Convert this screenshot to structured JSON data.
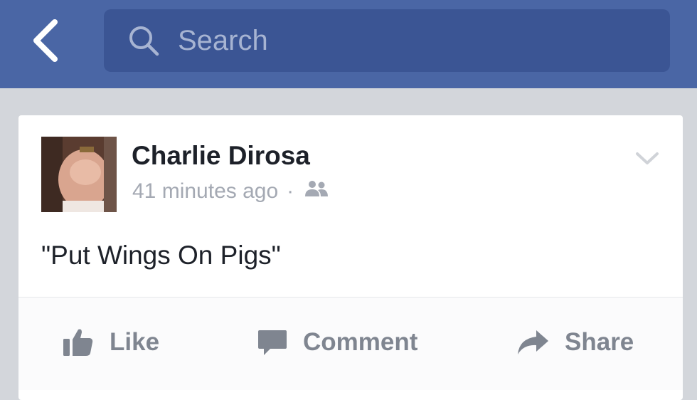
{
  "header": {
    "search_placeholder": "Search"
  },
  "post": {
    "author": "Charlie Dirosa",
    "timestamp": "41 minutes ago",
    "separator": "·",
    "privacy_icon": "friends-icon",
    "text": "\"Put Wings On Pigs\""
  },
  "actions": {
    "like_label": "Like",
    "comment_label": "Comment",
    "share_label": "Share"
  },
  "colors": {
    "navbar": "#4a66a5",
    "search_bg": "#3b5594",
    "background": "#d3d6db",
    "action_text": "#7f8590",
    "meta_text": "#a4a9b3"
  }
}
